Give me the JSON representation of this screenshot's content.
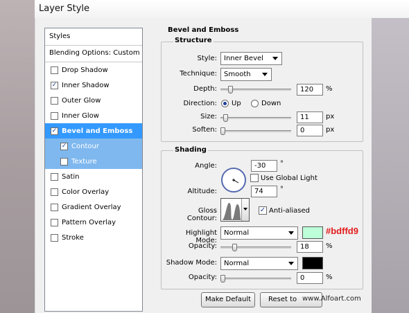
{
  "window": {
    "title": "Layer Style"
  },
  "styles_panel": {
    "header": "Styles",
    "blending": "Blending Options: Custom",
    "items": [
      {
        "label": "Drop Shadow",
        "checked": false
      },
      {
        "label": "Inner Shadow",
        "checked": true
      },
      {
        "label": "Outer Glow",
        "checked": false
      },
      {
        "label": "Inner Glow",
        "checked": false
      },
      {
        "label": "Bevel and Emboss",
        "checked": true
      },
      {
        "label": "Contour",
        "checked": true
      },
      {
        "label": "Texture",
        "checked": false
      },
      {
        "label": "Satin",
        "checked": false
      },
      {
        "label": "Color Overlay",
        "checked": false
      },
      {
        "label": "Gradient Overlay",
        "checked": false
      },
      {
        "label": "Pattern Overlay",
        "checked": false
      },
      {
        "label": "Stroke",
        "checked": false
      }
    ]
  },
  "bevel": {
    "title": "Bevel and Emboss",
    "structure": {
      "legend": "Structure",
      "style_label": "Style:",
      "style_value": "Inner Bevel",
      "technique_label": "Technique:",
      "technique_value": "Smooth",
      "depth_label": "Depth:",
      "depth_value": "120",
      "depth_unit": "%",
      "depth_level": 0.12,
      "direction_label": "Direction:",
      "direction_up": "Up",
      "direction_down": "Down",
      "size_label": "Size:",
      "size_value": "11",
      "size_unit": "px",
      "size_level": 0.045,
      "soften_label": "Soften:",
      "soften_value": "0",
      "soften_unit": "px",
      "soften_level": 0.0
    },
    "shading": {
      "legend": "Shading",
      "angle_label": "Angle:",
      "angle_value": "-30",
      "angle_unit": "°",
      "global_light_label": "Use Global Light",
      "altitude_label": "Altitude:",
      "altitude_value": "74",
      "altitude_unit": "°",
      "gloss_label": "Gloss Contour:",
      "antialiased_label": "Anti-aliased",
      "highlight_label": "Highlight Mode:",
      "highlight_value": "Normal",
      "highlight_color": "#bdffd9",
      "highlight_hex": "#bdffd9",
      "highlight_opacity_label": "Opacity:",
      "highlight_opacity_value": "18",
      "highlight_opacity_unit": "%",
      "shadow_label": "Shadow Mode:",
      "shadow_value": "Normal",
      "shadow_color": "#000000",
      "shadow_opacity_label": "Opacity:",
      "shadow_opacity_value": "0",
      "shadow_opacity_unit": "%"
    }
  },
  "buttons": {
    "make_default": "Make Default",
    "reset_default": "Reset to Default"
  },
  "watermark": "www.Alfoart.com"
}
